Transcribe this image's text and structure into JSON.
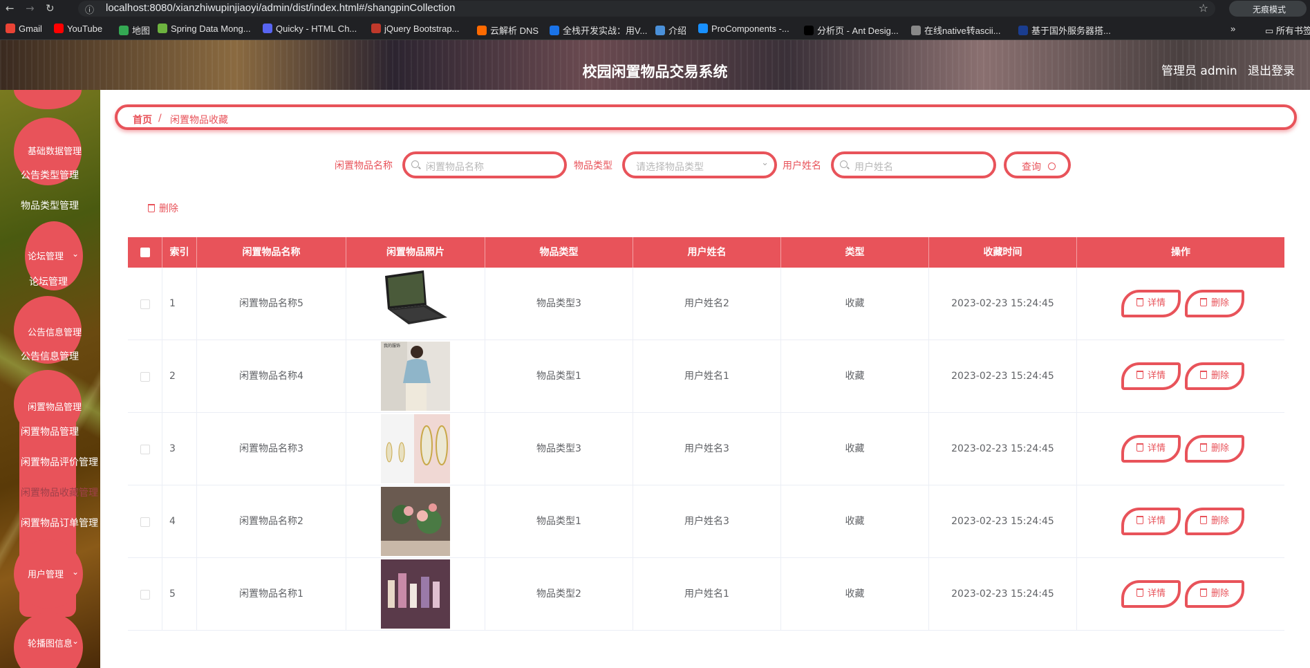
{
  "browser": {
    "url": "localhost:8080/xianzhiwupinjiaoyi/admin/dist/index.html#/shangpinCollection",
    "incognito_label": "无痕模式",
    "bookmarks": [
      {
        "label": "Gmail",
        "color": "#ea4335"
      },
      {
        "label": "YouTube",
        "color": "#ff0000"
      },
      {
        "label": "地图",
        "color": "#34a853"
      },
      {
        "label": "Spring Data Mong...",
        "color": "#6db33f"
      },
      {
        "label": "Quicky - HTML Ch...",
        "color": "#5865f2"
      },
      {
        "label": "jQuery Bootstrap...",
        "color": "#c0392b"
      },
      {
        "label": "云解析 DNS",
        "color": "#ff6a00"
      },
      {
        "label": "全栈开发实战：用V...",
        "color": "#1a73e8"
      },
      {
        "label": "介绍",
        "color": "#4a90d9"
      },
      {
        "label": "ProComponents -...",
        "color": "#1890ff"
      },
      {
        "label": "分析页 - Ant Desig...",
        "color": "#000000"
      },
      {
        "label": "在线native转ascii...",
        "color": "#888888"
      },
      {
        "label": "基于国外服务器搭...",
        "color": "#1a3d8f"
      }
    ],
    "all_bookmarks": "所有书签"
  },
  "header": {
    "title": "校园闲置物品交易系统",
    "admin": "管理员 admin",
    "logout": "退出登录"
  },
  "sidebar": {
    "groups": [
      {
        "title": "基础数据管理",
        "items": [
          "公告类型管理",
          "物品类型管理"
        ]
      },
      {
        "title": "论坛管理",
        "items": [
          "论坛管理"
        ]
      },
      {
        "title": "公告信息管理",
        "items": [
          "公告信息管理"
        ]
      },
      {
        "title": "闲置物品管理",
        "items": [
          "闲置物品管理",
          "闲置物品评价管理",
          "闲置物品收藏管理",
          "闲置物品订单管理"
        ]
      },
      {
        "title": "用户管理",
        "items": []
      },
      {
        "title": "轮播图信息",
        "items": []
      }
    ]
  },
  "breadcrumb": {
    "home": "首页",
    "separator": "/",
    "current": "闲置物品收藏"
  },
  "filters": {
    "name_label": "闲置物品名称",
    "name_placeholder": "闲置物品名称",
    "type_label": "物品类型",
    "type_placeholder": "请选择物品类型",
    "user_label": "用户姓名",
    "user_placeholder": "用户姓名",
    "query": "查询"
  },
  "toolbar": {
    "delete": "删除"
  },
  "table": {
    "headers": [
      "索引",
      "闲置物品名称",
      "闲置物品照片",
      "物品类型",
      "用户姓名",
      "类型",
      "收藏时间",
      "操作"
    ],
    "rows": [
      {
        "index": "1",
        "name": "闲置物品名称5",
        "photo": "laptop",
        "type": "物品类型3",
        "user": "用户姓名2",
        "kind": "收藏",
        "time": "2023-02-23 15:24:45"
      },
      {
        "index": "2",
        "name": "闲置物品名称4",
        "photo": "clothing",
        "type": "物品类型1",
        "user": "用户姓名1",
        "kind": "收藏",
        "time": "2023-02-23 15:24:45"
      },
      {
        "index": "3",
        "name": "闲置物品名称3",
        "photo": "earrings",
        "type": "物品类型3",
        "user": "用户姓名3",
        "kind": "收藏",
        "time": "2023-02-23 15:24:45"
      },
      {
        "index": "4",
        "name": "闲置物品名称2",
        "photo": "flowers",
        "type": "物品类型1",
        "user": "用户姓名3",
        "kind": "收藏",
        "time": "2023-02-23 15:24:45"
      },
      {
        "index": "5",
        "name": "闲置物品名称1",
        "photo": "cosmetics",
        "type": "物品类型2",
        "user": "用户姓名1",
        "kind": "收藏",
        "time": "2023-02-23 15:24:45"
      }
    ],
    "detail": "详情",
    "delete": "删除"
  },
  "colors": {
    "accent": "#e8535a"
  }
}
